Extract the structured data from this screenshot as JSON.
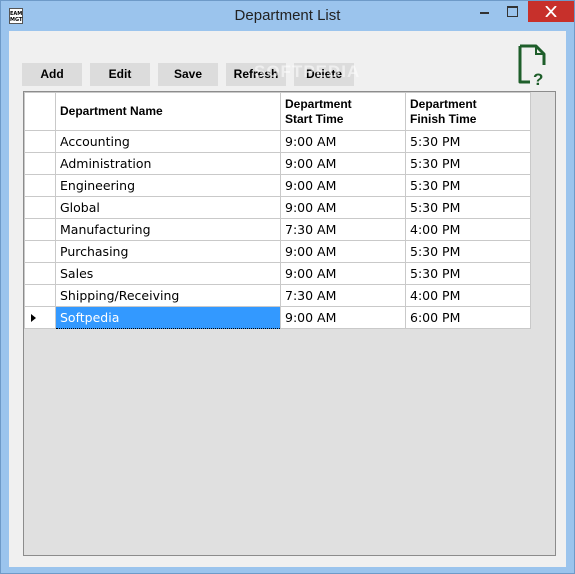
{
  "window": {
    "title": "Department List",
    "icon_text_top": "EAM",
    "icon_text_bottom": "MGT"
  },
  "toolbar": {
    "add_label": "Add",
    "edit_label": "Edit",
    "save_label": "Save",
    "refresh_label": "Refresh",
    "delete_label": "Delete"
  },
  "watermark": "SOFTPEDIA",
  "grid": {
    "columns": [
      "Department Name",
      "Department\nStart Time",
      "Department\nFinish Time"
    ],
    "col_start_line1": "Department",
    "col_start_line2": "Start Time",
    "col_end_line1": "Department",
    "col_end_line2": "Finish Time",
    "rows": [
      {
        "name": "Accounting",
        "start": "9:00 AM",
        "end": "5:30 PM"
      },
      {
        "name": "Administration",
        "start": "9:00 AM",
        "end": "5:30 PM"
      },
      {
        "name": "Engineering",
        "start": "9:00 AM",
        "end": "5:30 PM"
      },
      {
        "name": "Global",
        "start": "9:00 AM",
        "end": "5:30 PM"
      },
      {
        "name": "Manufacturing",
        "start": "7:30 AM",
        "end": "4:00 PM"
      },
      {
        "name": "Purchasing",
        "start": "9:00 AM",
        "end": "5:30 PM"
      },
      {
        "name": "Sales",
        "start": "9:00 AM",
        "end": "5:30 PM"
      },
      {
        "name": "Shipping/Receiving",
        "start": "7:30 AM",
        "end": "4:00 PM"
      },
      {
        "name": "Softpedia",
        "start": "9:00 AM",
        "end": "6:00 PM"
      }
    ],
    "selected_row": 8
  },
  "colors": {
    "titlebar": "#9bc4ed",
    "close": "#c7302b",
    "selection": "#3399ff",
    "help_icon": "#1e5e2a"
  },
  "icons": {
    "help": "document-help-icon",
    "current_row": "row-pointer-icon"
  }
}
